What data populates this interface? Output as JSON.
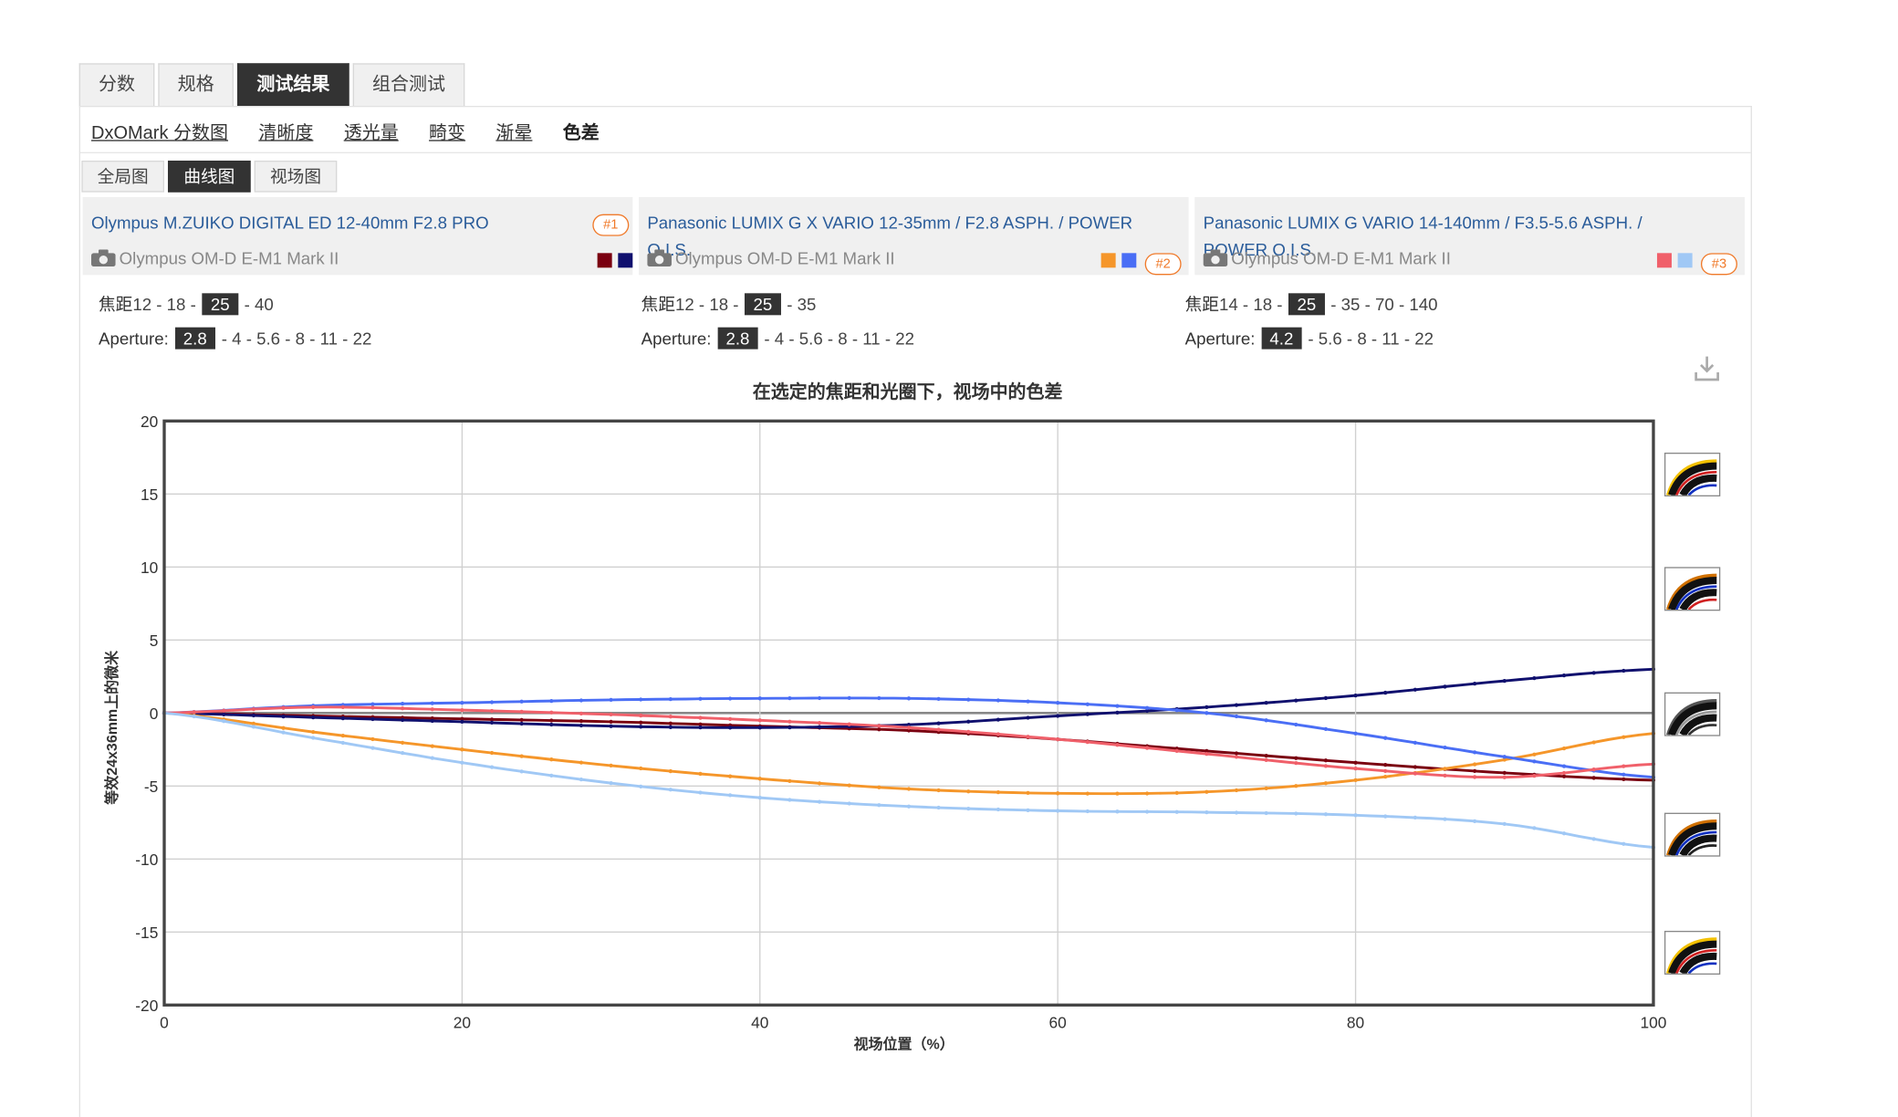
{
  "tabs": [
    {
      "label": "分数"
    },
    {
      "label": "规格"
    },
    {
      "label": "测试结果"
    },
    {
      "label": "组合测试"
    }
  ],
  "subnav": [
    {
      "label": "DxOMark 分数图"
    },
    {
      "label": "清晰度"
    },
    {
      "label": "透光量"
    },
    {
      "label": "畸变"
    },
    {
      "label": "渐晕"
    },
    {
      "label": "色差"
    }
  ],
  "view_tabs": [
    {
      "label": "全局图"
    },
    {
      "label": "曲线图"
    },
    {
      "label": "视场图"
    }
  ],
  "lenses": [
    {
      "name": "Olympus M.ZUIKO DIGITAL ED 12-40mm F2.8 PRO",
      "camera": "Olympus OM-D E-M1 Mark II",
      "badge": "#1",
      "colors": [
        "#7a0010",
        "#10106e"
      ],
      "focal_label": "焦距",
      "focal_pre": "12 - 18 - ",
      "focal_sel": "25",
      "focal_post": " - 40",
      "aperture_label": "Aperture: ",
      "aperture_sel": "2.8",
      "aperture_post": " - 4 - 5.6 - 8 - 11 - 22"
    },
    {
      "name": "Panasonic LUMIX G X VARIO 12-35mm / F2.8 ASPH. / POWER O.I.S.",
      "camera": "Olympus OM-D E-M1 Mark II",
      "badge": "#2",
      "colors": [
        "#f5962a",
        "#4a6ef5"
      ],
      "focal_label": "焦距",
      "focal_pre": "12 - 18 - ",
      "focal_sel": "25",
      "focal_post": " - 35",
      "aperture_label": "Aperture: ",
      "aperture_sel": "2.8",
      "aperture_post": " - 4 - 5.6 - 8 - 11 - 22"
    },
    {
      "name": "Panasonic LUMIX G VARIO 14-140mm / F3.5-5.6 ASPH. / POWER O.I.S.",
      "camera": "Olympus OM-D E-M1 Mark II",
      "badge": "#3",
      "colors": [
        "#f0606a",
        "#a0c8f5"
      ],
      "focal_label": "焦距",
      "focal_pre": "14 - 18 - ",
      "focal_sel": "25",
      "focal_post": " - 35 - 70 - 140",
      "aperture_label": "Aperture: ",
      "aperture_sel": "4.2",
      "aperture_post": " - 5.6 - 8 - 11 - 22"
    }
  ],
  "chart_data": {
    "type": "line",
    "title": "在选定的焦距和光圈下，视场中的色差",
    "xlabel": "视场位置（%）",
    "ylabel": "等效24x36mm上的微米",
    "xlim": [
      0,
      100
    ],
    "ylim": [
      -20,
      20
    ],
    "xticks": [
      0,
      20,
      40,
      60,
      80,
      100
    ],
    "yticks": [
      20,
      15,
      10,
      5,
      0,
      -5,
      -10,
      -15,
      -20
    ],
    "grid": true,
    "legend": "none",
    "x": [
      0,
      10,
      20,
      30,
      40,
      50,
      60,
      70,
      80,
      90,
      100
    ],
    "series": [
      {
        "color": "#7a0010",
        "values": [
          0,
          -0.2,
          -0.4,
          -0.6,
          -0.9,
          -1.2,
          -1.8,
          -2.6,
          -3.4,
          -4.1,
          -4.6
        ]
      },
      {
        "color": "#10106e",
        "values": [
          0,
          -0.3,
          -0.6,
          -0.9,
          -1.0,
          -0.8,
          -0.2,
          0.4,
          1.2,
          2.2,
          3.0
        ]
      },
      {
        "color": "#f5962a",
        "values": [
          0,
          -1.3,
          -2.5,
          -3.6,
          -4.5,
          -5.2,
          -5.5,
          -5.4,
          -4.6,
          -3.2,
          -1.4
        ]
      },
      {
        "color": "#4a6ef5",
        "values": [
          0,
          0.5,
          0.7,
          0.9,
          1.0,
          1.0,
          0.7,
          0.0,
          -1.4,
          -3.0,
          -4.4
        ]
      },
      {
        "color": "#f0606a",
        "values": [
          0,
          0.4,
          0.2,
          -0.1,
          -0.5,
          -1.0,
          -1.8,
          -2.8,
          -3.8,
          -4.4,
          -3.5
        ]
      },
      {
        "color": "#a0c8f5",
        "values": [
          0,
          -1.7,
          -3.4,
          -4.8,
          -5.8,
          -6.4,
          -6.7,
          -6.8,
          -7.0,
          -7.6,
          -9.2
        ]
      }
    ]
  }
}
